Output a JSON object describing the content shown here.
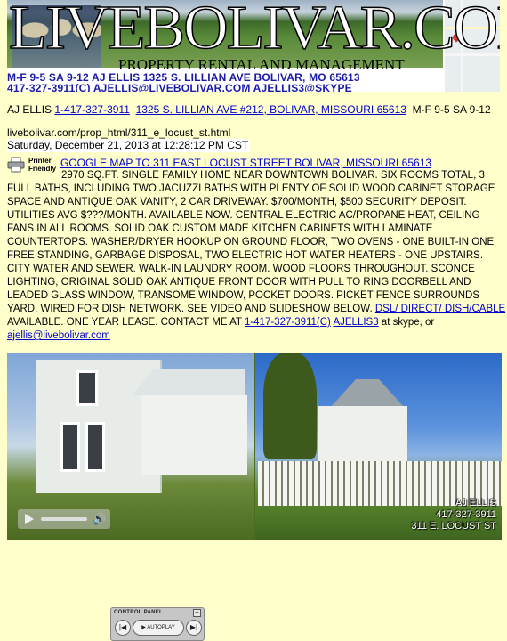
{
  "banner": {
    "title": "LIVEBOLIVAR.COM",
    "subtitle": "PROPERTY RENTAL AND MANAGEMENT",
    "line1": "M-F 9-5  SA 9-12   AJ ELLIS 1325 S. LILLIAN AVE BOLIVAR, MO 65613",
    "line2": "417-327-3911(C)   AJELLIS@LIVEBOLIVAR.COM   AJELLIS3@SKYPE"
  },
  "contact": {
    "name": "AJ ELLIS",
    "phone": "1-417-327-3911",
    "address": "1325 S. LILLIAN AVE #212, BOLIVAR, MISSOURI 65613",
    "hours": "M-F 9-5 SA 9-12"
  },
  "page_url": "livebolivar.com/prop_html/311_e_locust_st.html",
  "date": "Saturday, December 21, 2013 at 12:28:12 PM CST",
  "printer": {
    "label": "Printer Friendly",
    "icon": "printer-icon"
  },
  "map_link": "GOOGLE MAP TO 311 EAST LOCUST STREET BOLIVAR, MISSOURI 65613",
  "description": {
    "text": "2970 SQ.FT. SINGLE FAMILY HOME NEAR DOWNTOWN BOLIVAR.  SIX ROOMS TOTAL, 3 FULL BATHS, INCLUDING TWO JACUZZI BATHS WITH PLENTY OF SOLID WOOD CABINET STORAGE SPACE AND ANTIQUE OAK VANITY, 2 CAR DRIVEWAY.  $700/MONTH, $500 SECURITY DEPOSIT.  UTILITIES AVG $???/MONTH.  AVAILABLE NOW.  CENTRAL ELECTRIC AC/PROPANE HEAT, CEILING FANS IN ALL ROOMS.  SOLID OAK CUSTOM MADE KITCHEN CABINETS WITH LAMINATE COUNTERTOPS.  WASHER/DRYER HOOKUP ON GROUND FLOOR, TWO OVENS - ONE BUILT-IN ONE FREE STANDING, GARBAGE DISPOSAL, TWO ELECTRIC HOT WATER HEATERS - ONE UPSTAIRS.  CITY WATER AND SEWER.  WALK-IN LAUNDRY ROOM.  WOOD FLOORS THROUGHOUT.  SCONCE LIGHTING, ORIGINAL SOLID OAK ANTIQUE FRONT DOOR WITH PULL TO RING DOORBELL AND LEADED GLASS WINDOW, TRANSOME WINDOW, POCKET DOORS.  PICKET FENCE SURROUNDS YARD.   WIRED FOR DISH NETWORK.  SEE VIDEO AND SLIDESHOW BELOW.",
    "dsl_link": "DSL/ DIRECT/ DISH/CABLE",
    "after_dsl": " AVAILABLE.  ONE YEAR LEASE.  CONTACT ME AT ",
    "phone_link": "1-417-327-3911(C)",
    "skype_link": "AJELLIS3",
    "after_skype": " at skype, or ",
    "email_link": "ajellis@livebolivar.com"
  },
  "video": {
    "overlay_name": "AJ ELLIS",
    "overlay_phone": "417-327-3911",
    "overlay_address": "311 E. LOCUST ST"
  },
  "control_panel": {
    "title": "CONTROL PANEL",
    "autoplay": "AUTOPLAY",
    "prev_icon": "prev-icon",
    "next_icon": "next-icon"
  }
}
